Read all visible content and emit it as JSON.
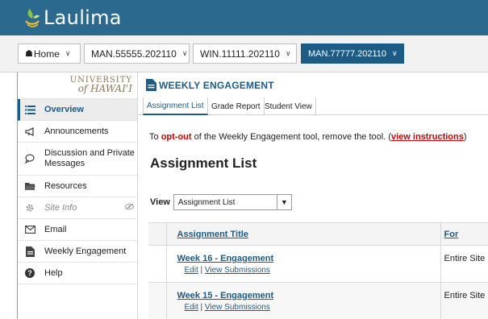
{
  "app": {
    "name": "Laulima"
  },
  "site_tabs": [
    {
      "label": "Home"
    },
    {
      "label": "MAN.55555.202110"
    },
    {
      "label": "WIN.11111.202110"
    },
    {
      "label": "MAN.77777.202110"
    }
  ],
  "brand": {
    "line1": "UNIVERSITY",
    "line2": "of HAWAI'I"
  },
  "sidebar": {
    "items": [
      {
        "label": "Overview",
        "icon": "list-icon"
      },
      {
        "label": "Announcements",
        "icon": "megaphone-icon"
      },
      {
        "label": "Discussion and Private Messages",
        "icon": "chat-icon"
      },
      {
        "label": "Resources",
        "icon": "folder-icon"
      },
      {
        "label": "Site Info",
        "icon": "gear-icon"
      },
      {
        "label": "Email",
        "icon": "envelope-icon"
      },
      {
        "label": "Weekly Engagement",
        "icon": "document-icon"
      },
      {
        "label": "Help",
        "icon": "help-icon"
      }
    ]
  },
  "tool": {
    "title": "WEEKLY ENGAGEMENT",
    "tabs": [
      {
        "label": "Assignment List"
      },
      {
        "label": "Grade Report"
      },
      {
        "label": "Student View"
      }
    ],
    "optout": {
      "prefix": "To ",
      "highlight": "opt-out",
      "middle": " of the Weekly Engagement tool, remove the tool. (",
      "link": "view instructions",
      "suffix": ")"
    },
    "heading": "Assignment List",
    "view": {
      "label": "View",
      "selected": "Assignment List"
    },
    "table": {
      "headers": {
        "title": "Assignment Title",
        "for": "For"
      },
      "rows": [
        {
          "title": "Week 16 - Engagement",
          "edit": "Edit",
          "sep": "|",
          "submissions": "View Submissions",
          "for": "Entire Site"
        },
        {
          "title": "Week 15 - Engagement",
          "edit": "Edit",
          "sep": "|",
          "submissions": "View Submissions",
          "for": "Entire Site"
        }
      ]
    }
  },
  "colors": {
    "header": "#2b6a8e",
    "accent": "#1c5b85",
    "alert": "#cc0000"
  }
}
